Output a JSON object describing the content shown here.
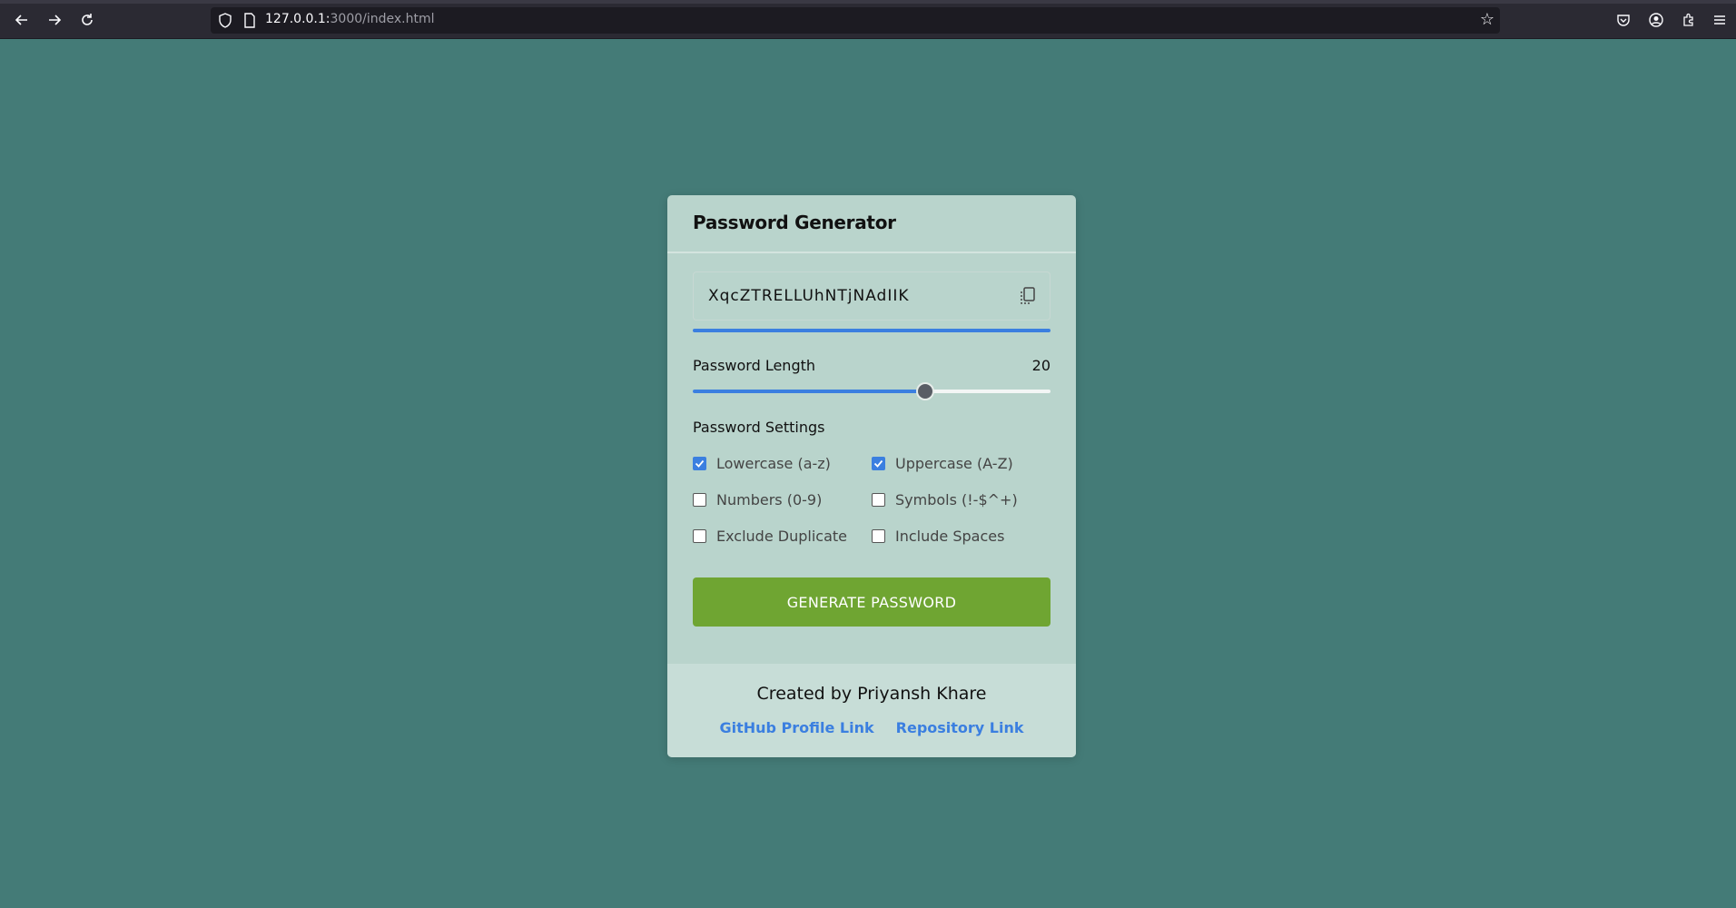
{
  "browser": {
    "url_host": "127.0.0.1:",
    "url_rest": "3000/index.html"
  },
  "card": {
    "title": "Password Generator",
    "password": "XqcZTRELLUhNTjNAdIIK",
    "strength_color": "#3b7fe0",
    "length_label": "Password Length",
    "length_value": "20",
    "length_slider_fraction": 0.65,
    "settings_label": "Password Settings",
    "options": [
      {
        "label": "Lowercase (a-z)",
        "checked": true
      },
      {
        "label": "Uppercase (A-Z)",
        "checked": true
      },
      {
        "label": "Numbers (0-9)",
        "checked": false
      },
      {
        "label": "Symbols (!-$^+)",
        "checked": false
      },
      {
        "label": "Exclude Duplicate",
        "checked": false
      },
      {
        "label": "Include Spaces",
        "checked": false
      }
    ],
    "generate_label": "GENERATE PASSWORD"
  },
  "footer": {
    "created_by": "Created by Priyansh Khare",
    "github_link": "GitHub Profile Link",
    "repo_link": "Repository Link"
  },
  "colors": {
    "background": "#447b77",
    "card": "#b9d4cc",
    "accent": "#3b7fe0",
    "button": "#6fa532"
  }
}
